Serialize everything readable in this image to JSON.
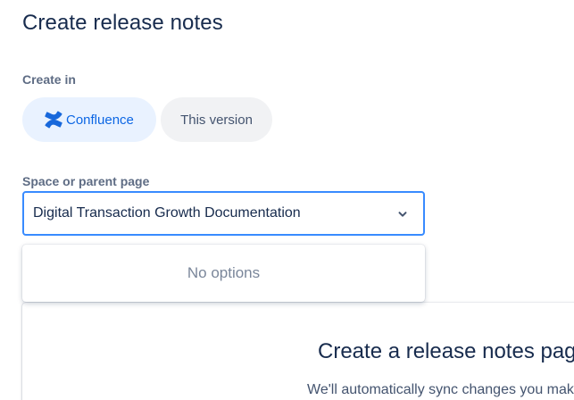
{
  "header": {
    "title": "Create release notes"
  },
  "create_in": {
    "label": "Create in",
    "options": [
      {
        "label": "Confluence",
        "selected": true,
        "icon": "confluence-logo-icon"
      },
      {
        "label": "This version",
        "selected": false
      }
    ]
  },
  "space": {
    "label": "Space or parent page",
    "value": "Digital Transaction Growth Documentation",
    "dropdown_empty": "No options"
  },
  "card": {
    "title": "Create a release notes page",
    "subtitle": "We'll automatically sync changes you make"
  },
  "colors": {
    "accent": "#0c66e4",
    "focus_border": "#388bff",
    "selected_pill_bg": "#e9f2ff",
    "pill_bg": "#f1f2f4"
  }
}
